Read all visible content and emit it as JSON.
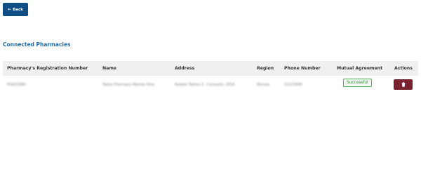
{
  "back_button": {
    "label": "Back",
    "icon": "arrow-left-icon"
  },
  "section_title": "Connected Pharmacies",
  "table": {
    "headers": [
      "Pharmacy's Registration Number",
      "Name",
      "Address",
      "Region",
      "Phone Number",
      "Mutual Agreement",
      "Actions"
    ],
    "rows": [
      {
        "registration_number": "PHA01089",
        "name": "Todorj Pharmacy Mamas Dina",
        "address": "Kolljets Todrao 3 , Consuells, 2016",
        "region": "Nicosia",
        "phone": "22123999",
        "agreement": "Successful",
        "action_icon": "trash-icon"
      }
    ]
  },
  "colors": {
    "primary": "#0f4f86",
    "title": "#1f6aa5",
    "success": "#4caf50",
    "danger": "#7a2130",
    "header_bg": "#f0f0f0"
  }
}
